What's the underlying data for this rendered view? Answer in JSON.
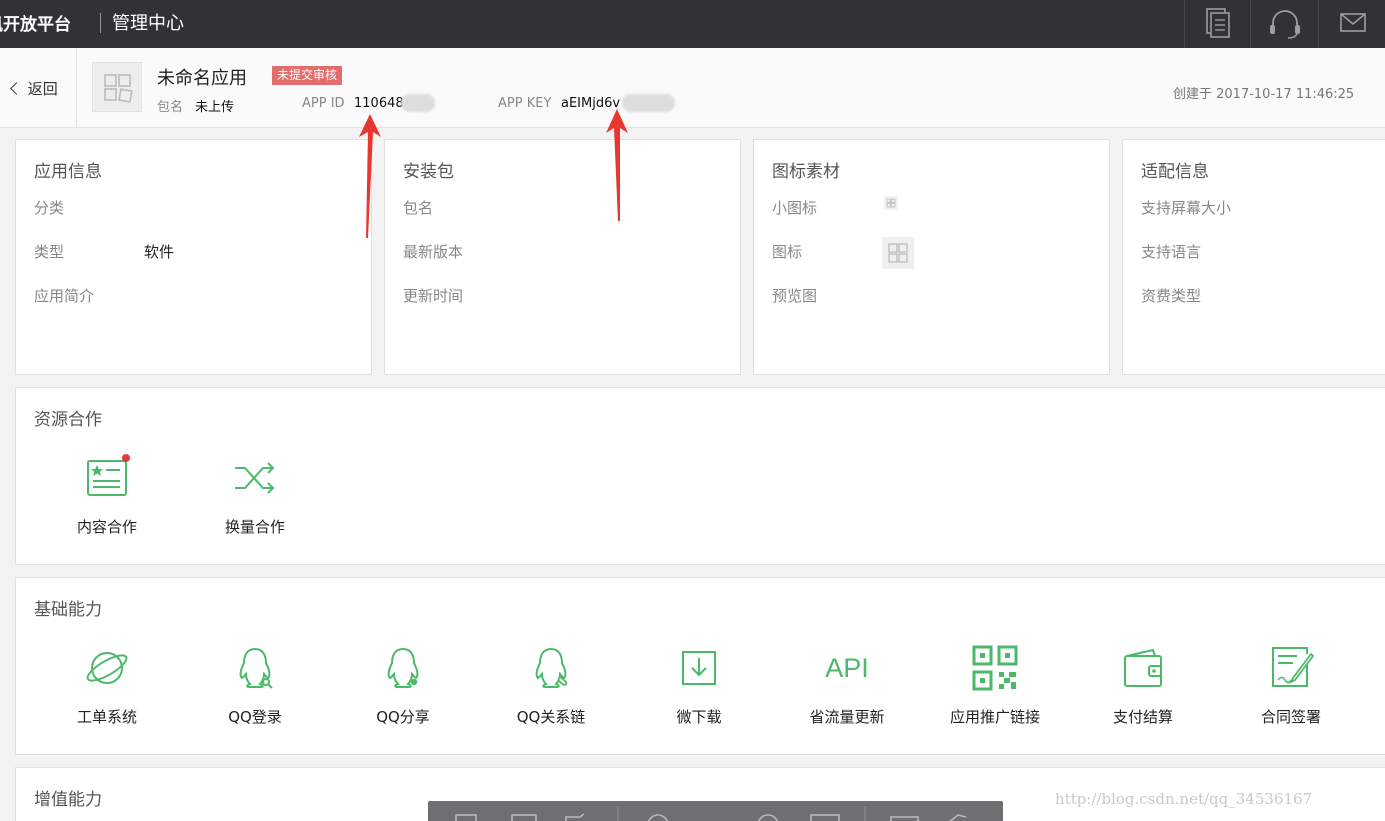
{
  "topbar": {
    "brand": "讯开放平台",
    "section": "管理中心",
    "icons": [
      "document-icon",
      "headset-icon",
      "mail-icon"
    ]
  },
  "app": {
    "back_label": "返回",
    "name": "未命名应用",
    "status_badge": "未提交审核",
    "package_label": "包名",
    "package_value": "未上传",
    "app_id_label": "APP ID",
    "app_id_value": "110648",
    "app_key_label": "APP KEY",
    "app_key_value": "aEIMjd6v",
    "created": "创建于 2017-10-17 11:46:25"
  },
  "cards": [
    {
      "title": "应用信息",
      "rows": [
        {
          "label": "分类",
          "value": ""
        },
        {
          "label": "类型",
          "value": "软件"
        },
        {
          "label": "应用简介",
          "value": ""
        }
      ]
    },
    {
      "title": "安装包",
      "rows": [
        {
          "label": "包名",
          "value": ""
        },
        {
          "label": "最新版本",
          "value": ""
        },
        {
          "label": "更新时间",
          "value": ""
        }
      ]
    },
    {
      "title": "图标素材",
      "rows": [
        {
          "label": "小图标",
          "value": ""
        },
        {
          "label": "图标",
          "value": ""
        },
        {
          "label": "预览图",
          "value": ""
        }
      ]
    },
    {
      "title": "适配信息",
      "rows": [
        {
          "label": "支持屏幕大小",
          "value": ""
        },
        {
          "label": "支持语言",
          "value": ""
        },
        {
          "label": "资费类型",
          "value": ""
        }
      ]
    }
  ],
  "resources": {
    "title": "资源合作",
    "items": [
      {
        "label": "内容合作",
        "icon": "content-card-icon"
      },
      {
        "label": "换量合作",
        "icon": "shuffle-icon"
      }
    ]
  },
  "basic": {
    "title": "基础能力",
    "items": [
      {
        "label": "工单系统",
        "icon": "planet-icon"
      },
      {
        "label": "QQ登录",
        "icon": "qq-login-icon"
      },
      {
        "label": "QQ分享",
        "icon": "qq-share-icon"
      },
      {
        "label": "QQ关系链",
        "icon": "qq-relation-icon"
      },
      {
        "label": "微下载",
        "icon": "download-icon"
      },
      {
        "label": "省流量更新",
        "icon": "api-icon",
        "glyph": "API"
      },
      {
        "label": "应用推广链接",
        "icon": "qrcode-icon"
      },
      {
        "label": "支付结算",
        "icon": "wallet-icon"
      },
      {
        "label": "合同签署",
        "icon": "contract-icon"
      }
    ]
  },
  "value_added": {
    "title": "增值能力"
  },
  "watermark": "http://blog.csdn.net/qq_34536167",
  "colors": {
    "accent": "#4cb86a",
    "topbar": "#2f3236",
    "badge": "#e36d6d",
    "arrow": "#e8372f"
  }
}
